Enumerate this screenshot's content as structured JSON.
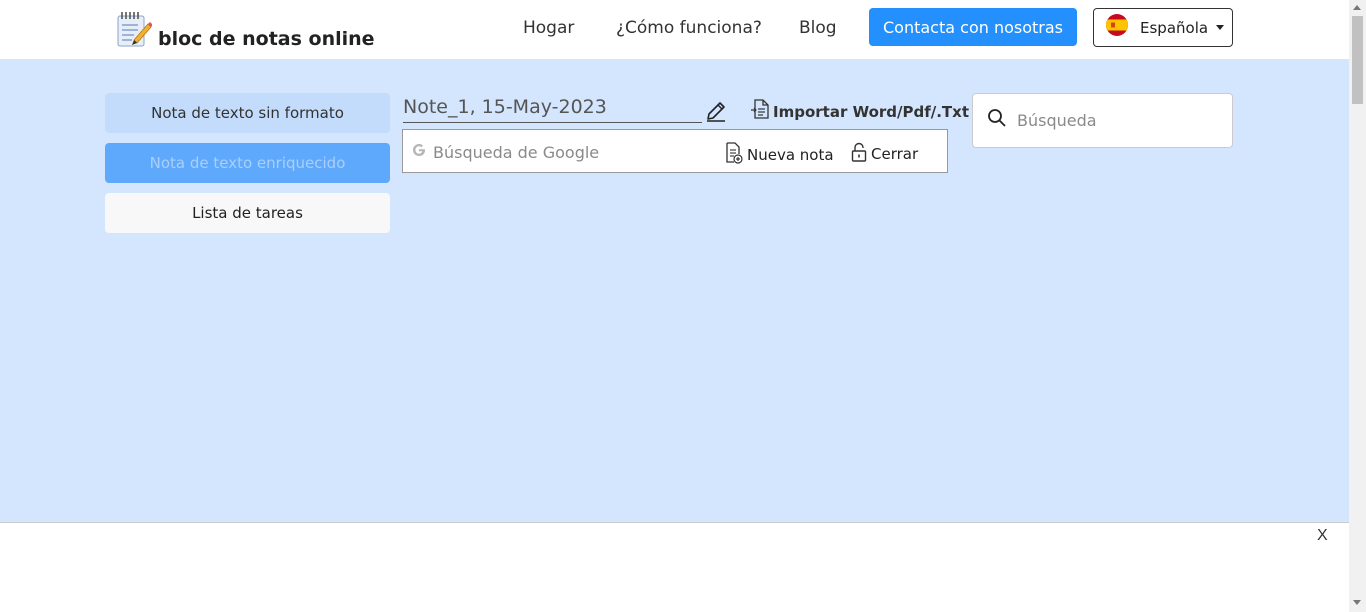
{
  "header": {
    "logo_text": "bloc de notas online",
    "nav": [
      "Hogar",
      "¿Cómo funciona?",
      "Blog"
    ],
    "contact_label": "Contacta con nosotras",
    "language_label": "Española"
  },
  "sidebar": {
    "items": [
      {
        "label": "Nota de texto sin formato",
        "active": false
      },
      {
        "label": "Nota de texto enriquecido",
        "active": true
      },
      {
        "label": "Lista de tareas",
        "active": false
      }
    ]
  },
  "editor": {
    "note_title": "Note_1, 15-May-2023",
    "import_label": "Importar Word/Pdf/.Txt",
    "google_search_placeholder": "Búsqueda de Google",
    "new_note_label": "Nueva nota",
    "close_label": "Cerrar"
  },
  "search": {
    "placeholder": "Búsqueda"
  },
  "ad": {
    "close_label": "X"
  },
  "colors": {
    "accent": "#2490fd",
    "page_background": "#d3e6fd",
    "active_tab": "#5fa9fc"
  },
  "icons": [
    "notepad-logo-icon",
    "spain-flag-icon",
    "pencil-icon",
    "document-import-icon",
    "google-g-icon",
    "new-note-icon",
    "lock-icon",
    "search-icon"
  ]
}
